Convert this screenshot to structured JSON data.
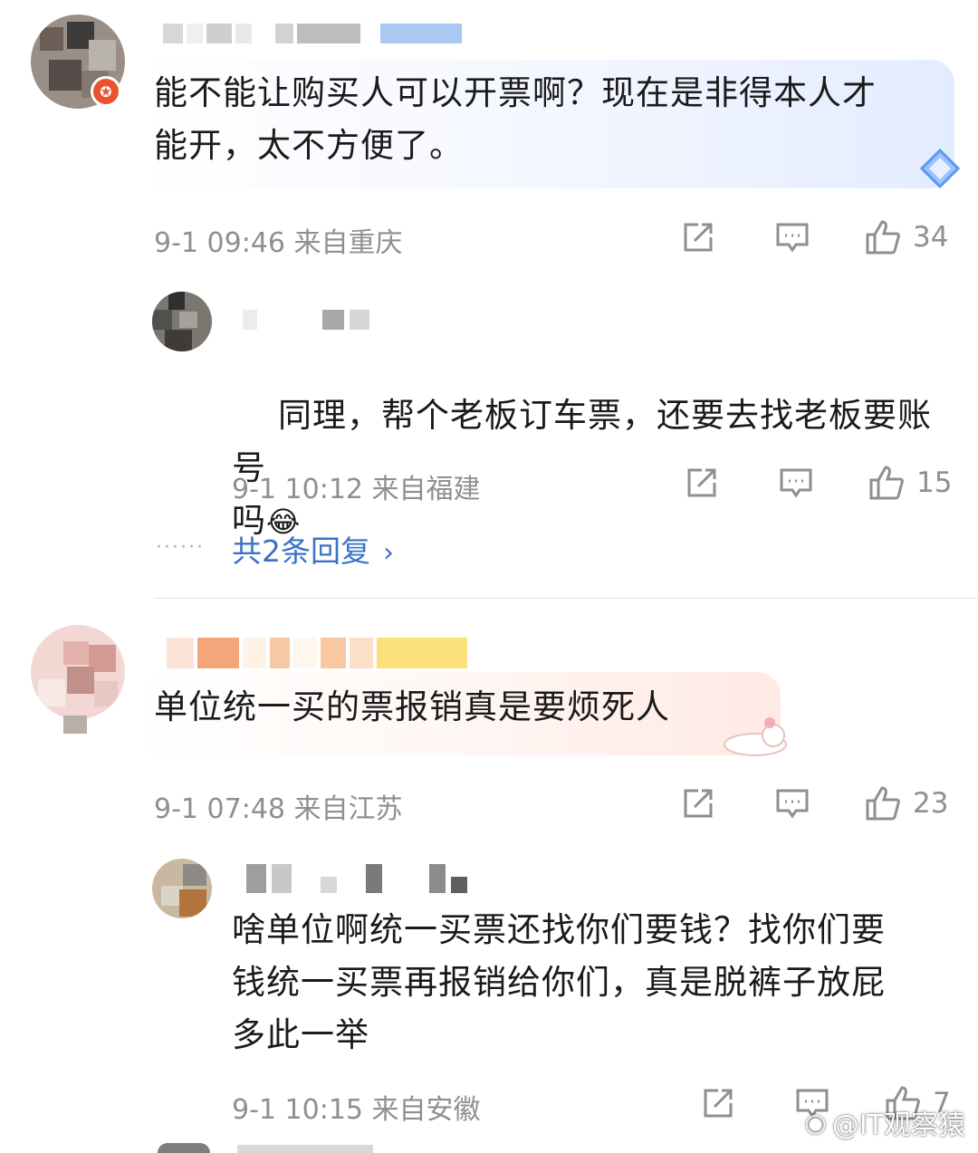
{
  "comments": [
    {
      "text": "能不能让购买人可以开票啊？现在是非得本人才\n能开，太不方便了。",
      "meta": "9-1 09:46  来自重庆",
      "likes": "34",
      "replies": [
        {
          "text": "同理，帮个老板订车票，还要去找老板要账号\n吗",
          "emoji": "😂",
          "meta": "9-1 10:12  来自福建",
          "likes": "15"
        }
      ],
      "more_replies": "共2条回复",
      "more_dots": "······"
    },
    {
      "text": "单位统一买的票报销真是要烦死人",
      "meta": "9-1 07:48  来自江苏",
      "likes": "23",
      "replies": [
        {
          "text": "啥单位啊统一买票还找你们要钱？找你们要\n钱统一买票再报销给你们，真是脱裤子放屁\n多此一举",
          "meta": "9-1 10:15  来自安徽",
          "likes": "7"
        }
      ]
    }
  ],
  "icons": {
    "share": "share-icon",
    "comment": "comment-icon",
    "like": "like-icon"
  },
  "watermark": "@IT观察猿",
  "colors": {
    "link": "#3b72c8",
    "meta": "#8f8f8f",
    "bubble_blue": "#eef3ff",
    "bubble_pink": "#fff1ee"
  }
}
